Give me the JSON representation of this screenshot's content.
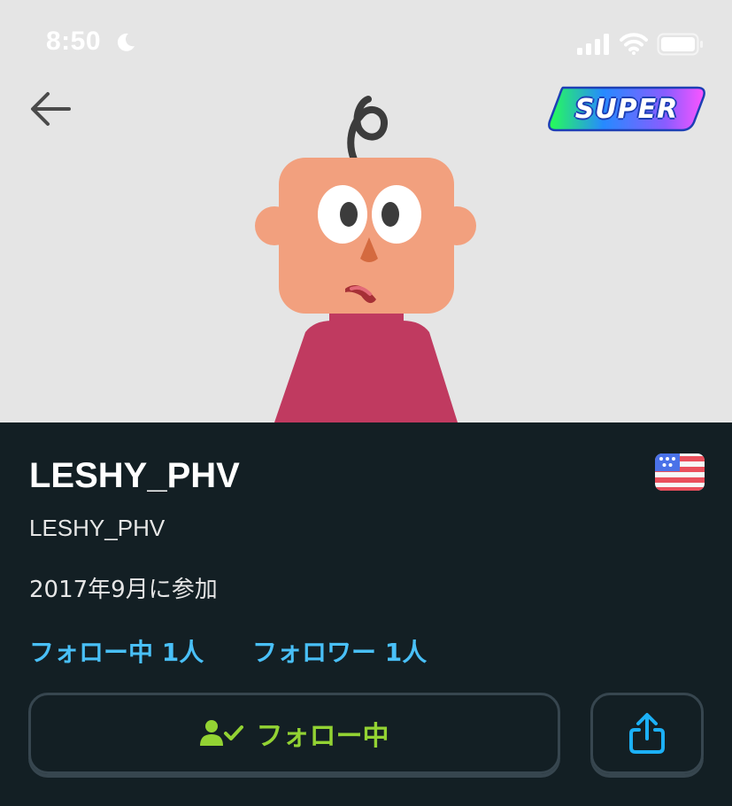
{
  "status_bar": {
    "time": "8:50",
    "icons": [
      "moon-icon",
      "cellular-signal-icon",
      "wifi-icon",
      "battery-icon"
    ]
  },
  "header": {
    "back_icon": "arrow-left-icon",
    "badge_label": "SUPER"
  },
  "profile": {
    "display_name": "LESHY_PHV",
    "username": "LESHY_PHV",
    "joined": "2017年9月に参加",
    "country_flag": "us-flag-icon",
    "following_count_label": "フォロー中 1人",
    "followers_count_label": "フォロワー 1人"
  },
  "actions": {
    "follow_button_label": "フォロー中",
    "follow_icon": "user-check-icon",
    "share_icon": "share-icon"
  },
  "colors": {
    "hero_bg": "#e5e5e5",
    "page_bg": "#131f24",
    "link_blue": "#49c0f8",
    "follow_green": "#93d333",
    "button_border": "#37464f",
    "avatar_skin": "#f2a07e",
    "avatar_shirt": "#c03a60"
  }
}
